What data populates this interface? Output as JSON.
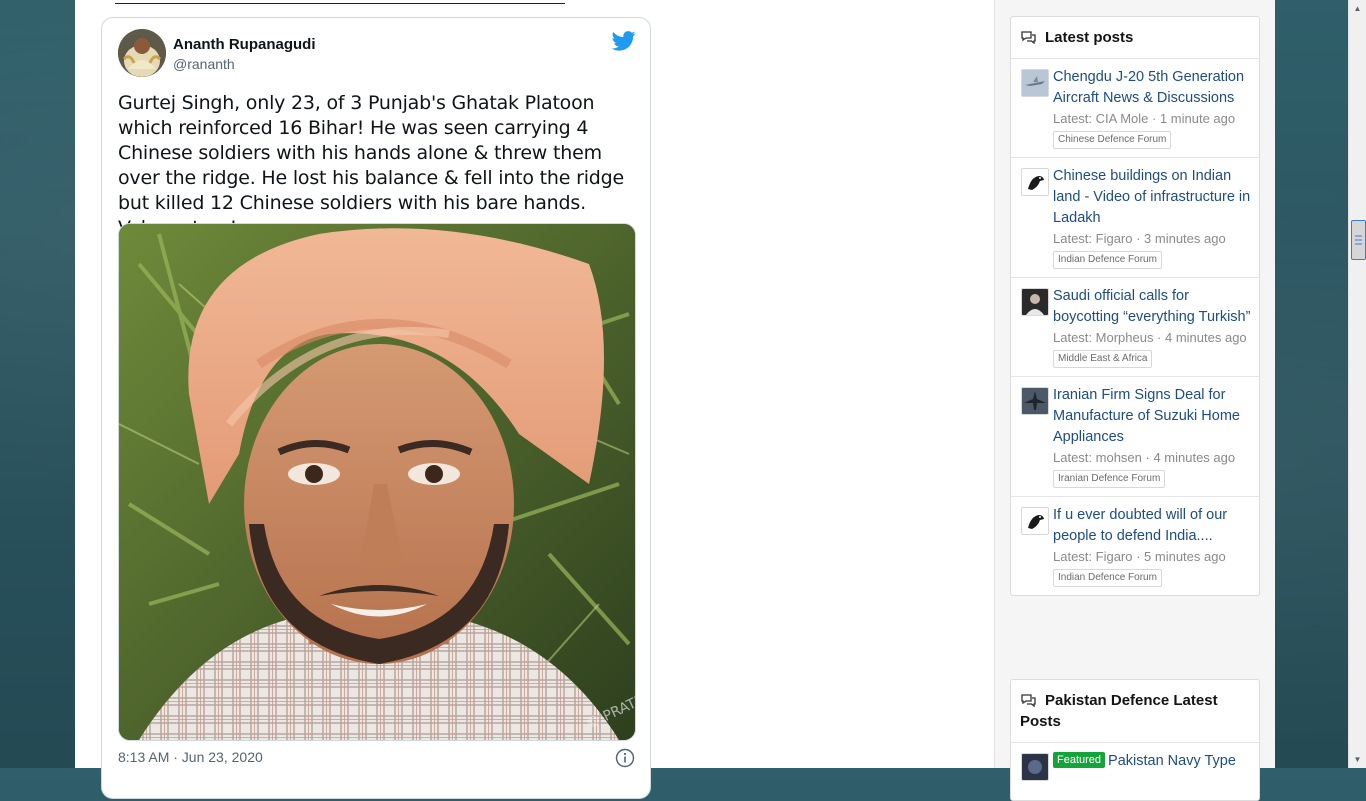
{
  "tweet": {
    "author_name": "Ananth Rupanagudi",
    "author_handle": "@rananth",
    "text": "Gurtej Singh, only 23, of 3 Punjab's Ghatak Platoon which reinforced 16 Bihar! He was seen carrying 4 Chinese soldiers with his hands alone & threw them over the ridge. He lost his balance & fell into the ridge but killed 12 Chinese soldiers with his bare hands. Valour story!",
    "timestamp": "8:13 AM · Jun 23, 2020",
    "brand_color": "#1d9bf0"
  },
  "latest_posts": {
    "heading": "Latest posts",
    "items": [
      {
        "title": "Chengdu J-20 5th Generation Aircraft News & Discussions",
        "meta": "Latest: CIA Mole · 1 minute ago",
        "forum": "Chinese Defence Forum",
        "thumb_icon": "jet-thumbnail"
      },
      {
        "title": "Chinese buildings on Indian land - Video of infrastructure in Ladakh",
        "meta": "Latest: Figaro · 3 minutes ago",
        "forum": "Indian Defence Forum",
        "thumb_icon": "bird-avatar"
      },
      {
        "title": "Saudi official calls for boycotting “everything Turkish”",
        "meta": "Latest: Morpheus · 4 minutes ago",
        "forum": "Middle East & Africa",
        "thumb_icon": "person-avatar"
      },
      {
        "title": "Iranian Firm Signs Deal for Manufacture of Suzuki Home Appliances",
        "meta": "Latest: mohsen · 4 minutes ago",
        "forum": "Iranian Defence Forum",
        "thumb_icon": "fighter-jet-avatar"
      },
      {
        "title": "If u ever doubted will of our people to defend India....",
        "meta": "Latest: Figaro · 5 minutes ago",
        "forum": "Indian Defence Forum",
        "thumb_icon": "bird-avatar"
      }
    ]
  },
  "pakistan_posts": {
    "heading": "Pakistan Defence Latest Posts",
    "first_item": {
      "badge": "Featured",
      "title": "Pakistan Navy Type"
    }
  },
  "colors": {
    "link": "#1d4c86",
    "featured": "#17a33c"
  }
}
